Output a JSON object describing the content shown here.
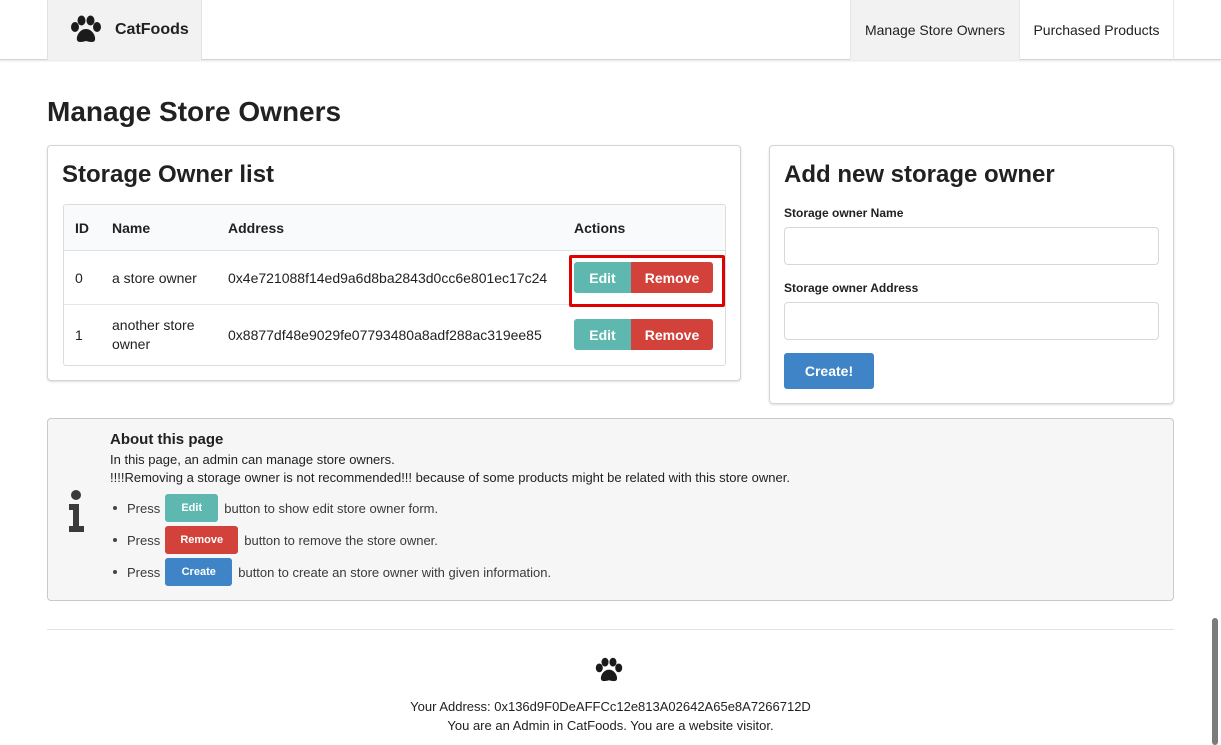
{
  "nav": {
    "brand": "CatFoods",
    "items": [
      "Manage Store Owners",
      "Purchased Products"
    ]
  },
  "page_title": "Manage Store Owners",
  "owner_list": {
    "title": "Storage Owner list",
    "columns": [
      "ID",
      "Name",
      "Address",
      "Actions"
    ],
    "rows": [
      {
        "id": "0",
        "name": "a store owner",
        "address": "0x4e721088f14ed9a6d8ba2843d0cc6e801ec17c24"
      },
      {
        "id": "1",
        "name": "another store owner",
        "address": "0x8877df48e9029fe07793480a8adf288ac319ee85"
      }
    ],
    "edit_label": "Edit",
    "remove_label": "Remove"
  },
  "add_form": {
    "title": "Add new storage owner",
    "name_label": "Storage owner Name",
    "name_value": "",
    "address_label": "Storage owner Address",
    "address_value": "",
    "submit_label": "Create!"
  },
  "info": {
    "header": "About this page",
    "line1": "In this page, an admin can manage store owners.",
    "line2": "!!!!Removing a storage owner is not recommended!!! because of some products might be related with this store owner.",
    "press": "Press",
    "bullets": [
      {
        "button": "Edit",
        "text": "button to show edit store owner form."
      },
      {
        "button": "Remove",
        "text": "button to remove the store owner."
      },
      {
        "button": "Create",
        "text": "button to create an store owner with given information."
      }
    ]
  },
  "footer": {
    "address_line": "Your Address: 0x136d9F0DeAFFCc12e813A02642A65e8A7266712D",
    "role_line": "You are an Admin in CatFoods. You are a website visitor."
  },
  "colors": {
    "edit": "#5fb8b0",
    "remove": "#d2413a",
    "create": "#3e84c6",
    "highlight": "#e00000"
  }
}
